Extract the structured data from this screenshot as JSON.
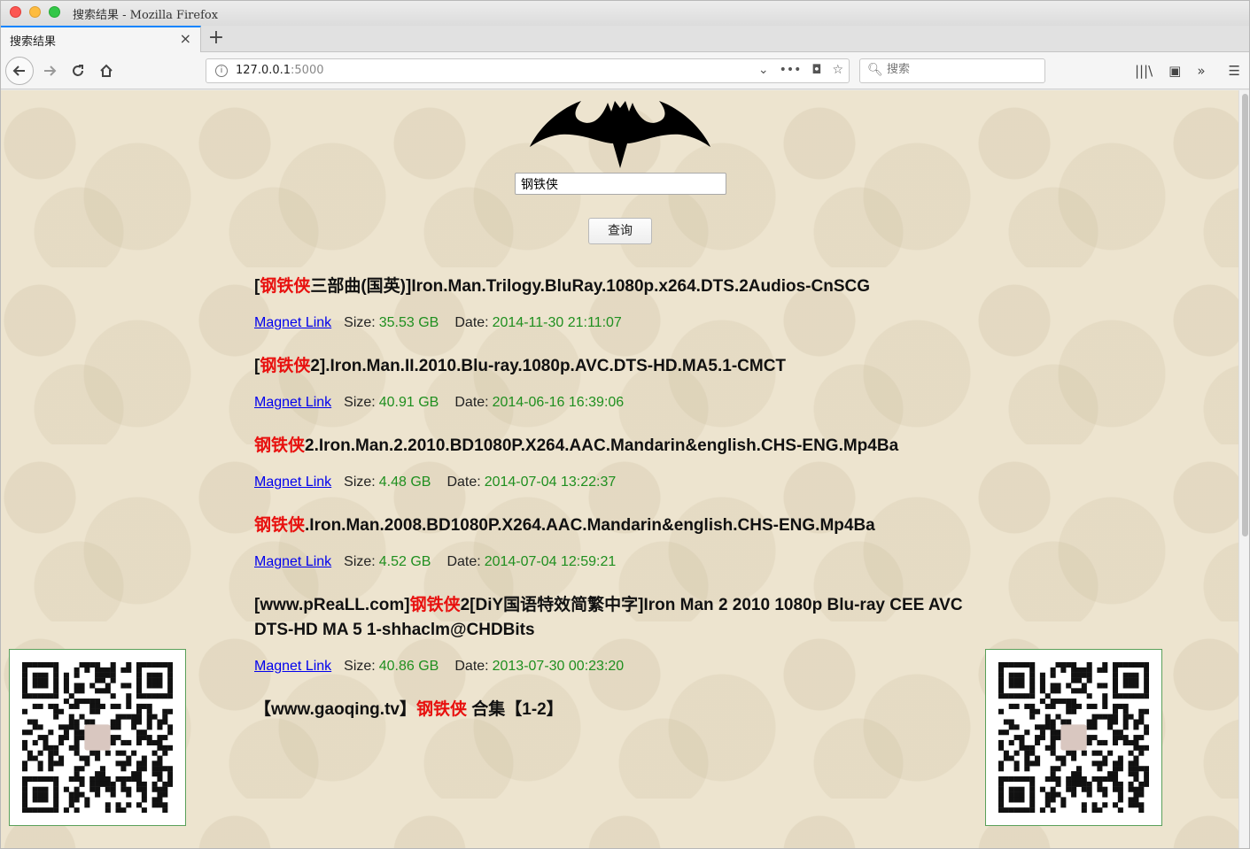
{
  "window": {
    "title": "搜索结果 - Mozilla Firefox"
  },
  "tab": {
    "label": "搜索结果",
    "close": "×",
    "new_tab": "+"
  },
  "nav": {
    "url_host": "127.0.0.1",
    "url_port": ":5000",
    "search_placeholder": "搜索"
  },
  "page": {
    "query_value": "钢铁侠",
    "query_button": "查询",
    "results": [
      {
        "prefix": "[",
        "hl": "钢铁侠",
        "rest": "三部曲(国英)]Iron.Man.Trilogy.BluRay.1080p.x264.DTS.2Audios-CnSCG",
        "link": "Magnet Link",
        "size_label": "Size:",
        "size": "35.53 GB",
        "date_label": "Date:",
        "date": "2014-11-30 21:11:07"
      },
      {
        "prefix": "[",
        "hl": "钢铁侠",
        "rest": "2].Iron.Man.II.2010.Blu-ray.1080p.AVC.DTS-HD.MA5.1-CMCT",
        "link": "Magnet Link",
        "size_label": "Size:",
        "size": "40.91 GB",
        "date_label": "Date:",
        "date": "2014-06-16 16:39:06"
      },
      {
        "prefix": "",
        "hl": "钢铁侠",
        "rest": "2.Iron.Man.2.2010.BD1080P.X264.AAC.Mandarin&english.CHS-ENG.Mp4Ba",
        "link": "Magnet Link",
        "size_label": "Size:",
        "size": "4.48 GB",
        "date_label": "Date:",
        "date": "2014-07-04 13:22:37"
      },
      {
        "prefix": "",
        "hl": "钢铁侠",
        "rest": ".Iron.Man.2008.BD1080P.X264.AAC.Mandarin&english.CHS-ENG.Mp4Ba",
        "link": "Magnet Link",
        "size_label": "Size:",
        "size": "4.52 GB",
        "date_label": "Date:",
        "date": "2014-07-04 12:59:21"
      },
      {
        "prefix": "[www.pReaLL.com]",
        "hl": "钢铁侠",
        "rest": "2[DiY国语特效简繁中字]Iron Man 2 2010 1080p Blu-ray CEE AVC DTS-HD MA 5 1-shhaclm@CHDBits",
        "link": "Magnet Link",
        "size_label": "Size:",
        "size": "40.86 GB",
        "date_label": "Date:",
        "date": "2013-07-30 00:23:20"
      },
      {
        "prefix": "【www.gaoqing.tv】",
        "hl": "钢铁侠",
        "rest": " 合集【1-2】",
        "link": "",
        "size_label": "",
        "size": "",
        "date_label": "",
        "date": ""
      }
    ]
  },
  "colors": {
    "highlight": "#e8100e",
    "value_green": "#1f8f1f",
    "link": "#0000ee",
    "bg": "#ede4cf"
  }
}
